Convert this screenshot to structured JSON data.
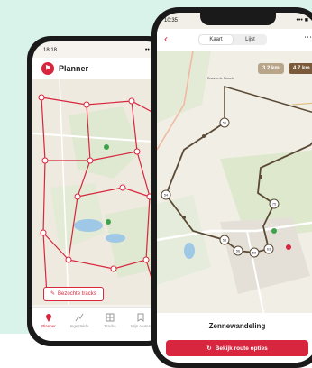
{
  "planner_phone": {
    "status_time": "18:18",
    "status_icons": "•• ■",
    "app_title": "Planner",
    "tracks_button": "Bezochte tracks",
    "tabs": [
      {
        "label": "Planner",
        "icon": "map-pin-icon",
        "active": true
      },
      {
        "label": "Ingestelde",
        "icon": "route-icon",
        "active": false
      },
      {
        "label": "Tracks",
        "icon": "grid-icon",
        "active": false
      },
      {
        "label": "Mijn routes",
        "icon": "bookmark-icon",
        "active": false
      }
    ]
  },
  "route_phone": {
    "status_time": "10:35",
    "status_icons": "••• ■",
    "view_tabs": [
      "Kaart",
      "Lijst"
    ],
    "active_view": "Kaart",
    "distance_badges": [
      {
        "text": "3.2 km",
        "color": "#b9a58a"
      },
      {
        "text": "4.7 km",
        "color": "#7a5a3a"
      }
    ],
    "map_labels": {
      "town": "Brasserie Bosch",
      "nodes": [
        "51",
        "54",
        "55",
        "56",
        "58",
        "63",
        "75"
      ]
    },
    "route_name": "Zennewandeling",
    "cta_label": "Bekijk route opties"
  },
  "colors": {
    "brand": "#d7263d",
    "mint_background": "#d9f3ea",
    "route_line": "#5b4a35"
  }
}
